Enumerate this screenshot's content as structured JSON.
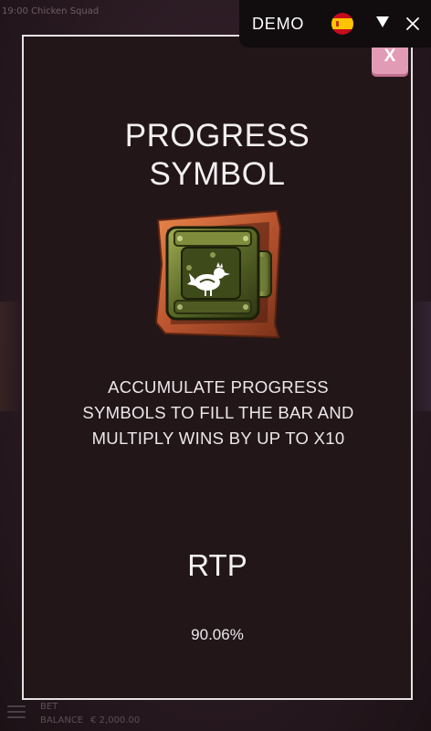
{
  "background": {
    "top_bar_text": "19:00 Chicken Squad",
    "bet_label": "BET",
    "bet_value": "€ ",
    "balance_label": "BALANCE",
    "balance_value": "€ 2,000.00"
  },
  "demo_bar": {
    "label": "DEMO",
    "flag_icon": "spain-flag-icon",
    "toggle_icon": "triangle-down-icon",
    "close_icon": "close-icon"
  },
  "modal": {
    "close_label": "X",
    "title": "PROGRESS\nSYMBOL",
    "symbol_icon": "progress-symbol-crate-icon",
    "description": "ACCUMULATE PROGRESS\nSYMBOLS TO FILL THE BAR AND\nMULTIPLY WINS BY UP TO X10",
    "rtp_label": "RTP",
    "rtp_value": "90.06%"
  },
  "colors": {
    "modal_background": "#221619",
    "modal_border": "#e6e2e4",
    "close_button": "#e29bb5",
    "demo_bar": "#110d0f",
    "text": "#f3f0f1",
    "flag_red": "#c60b1e",
    "flag_yellow": "#ffc400"
  }
}
